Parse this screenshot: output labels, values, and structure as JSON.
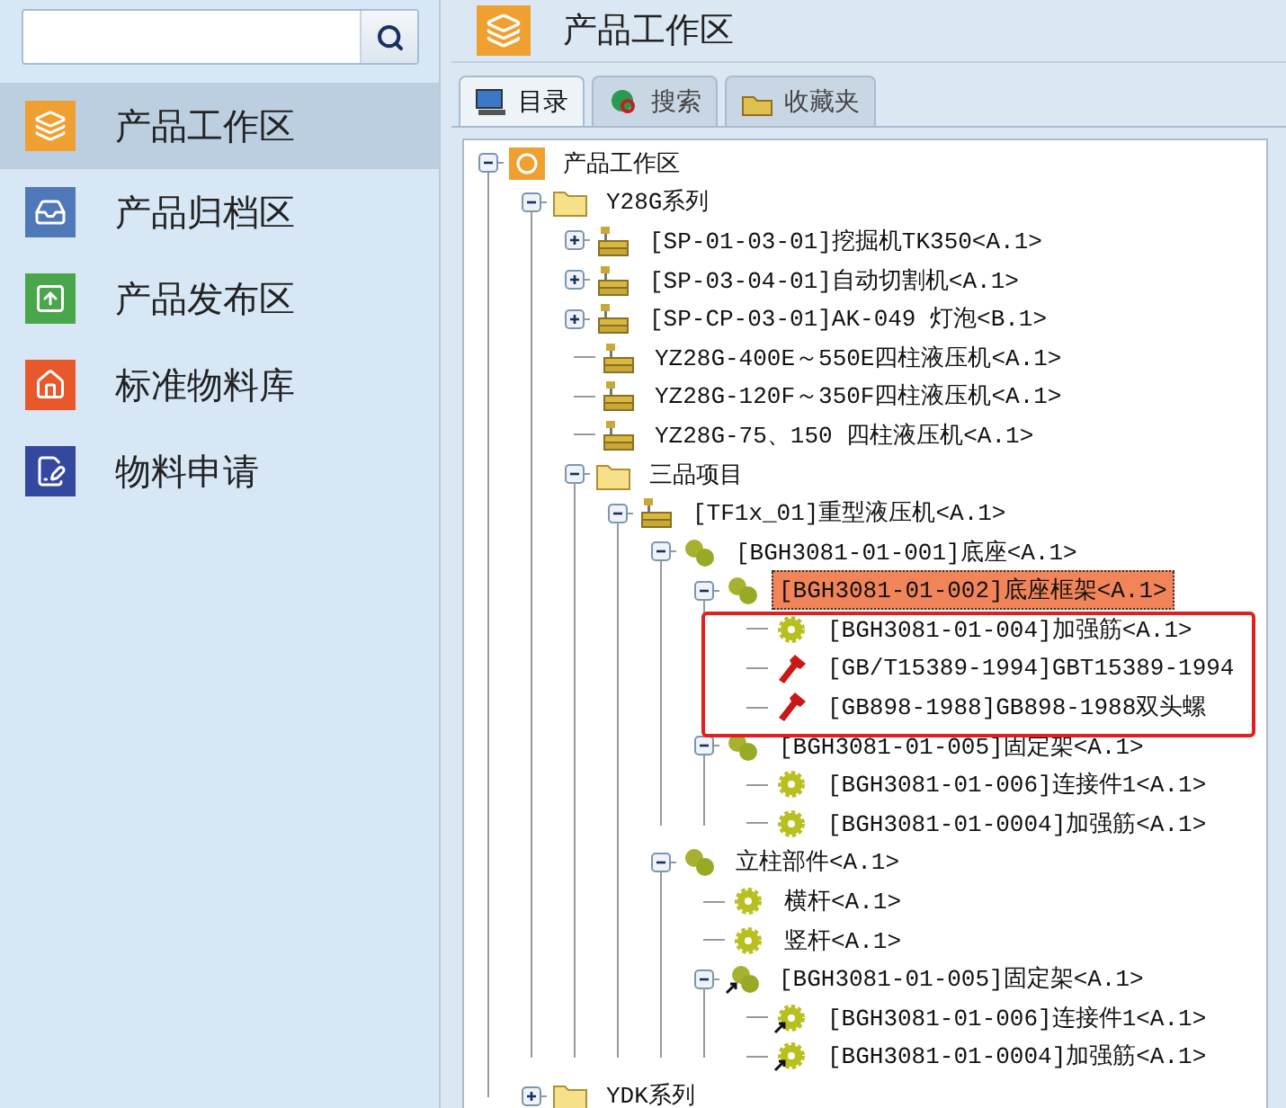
{
  "nav": [
    {
      "label": "产品工作区",
      "color": "#f0a030",
      "selected": true
    },
    {
      "label": "产品归档区",
      "color": "#4f78b8",
      "selected": false
    },
    {
      "label": "产品发布区",
      "color": "#4aa64a",
      "selected": false
    },
    {
      "label": "标准物料库",
      "color": "#e8582a",
      "selected": false
    },
    {
      "label": "物料申请",
      "color": "#3448a0",
      "selected": false
    }
  ],
  "header": {
    "title": "产品工作区"
  },
  "tabs": [
    {
      "label": "目录",
      "selected": true
    },
    {
      "label": "搜索",
      "selected": false
    },
    {
      "label": "收藏夹",
      "selected": false
    }
  ],
  "tree": [
    {
      "label": "产品工作区",
      "kind": "root",
      "expanded": true,
      "selected": false,
      "children": [
        {
          "label": "Y28G系列",
          "kind": "folder",
          "expanded": true,
          "selected": false,
          "children": [
            {
              "label": "[SP-01-03-01]挖掘机TK350<A.1>",
              "kind": "product",
              "expanded": false,
              "selected": false
            },
            {
              "label": "[SP-03-04-01]自动切割机<A.1>",
              "kind": "product",
              "expanded": false,
              "selected": false
            },
            {
              "label": "[SP-CP-03-01]AK-049 灯泡<B.1>",
              "kind": "product",
              "expanded": false,
              "selected": false
            },
            {
              "label": "YZ28G-400E～550E四柱液压机<A.1>",
              "kind": "product",
              "selected": false
            },
            {
              "label": "YZ28G-120F～350F四柱液压机<A.1>",
              "kind": "product",
              "selected": false
            },
            {
              "label": "YZ28G-75、150 四柱液压机<A.1>",
              "kind": "product",
              "selected": false
            },
            {
              "label": "三品项目",
              "kind": "folder",
              "expanded": true,
              "selected": false,
              "children": [
                {
                  "label": "[TF1x_01]重型液压机<A.1>",
                  "kind": "product",
                  "expanded": true,
                  "selected": false,
                  "children": [
                    {
                      "label": "[BGH3081-01-001]底座<A.1>",
                      "kind": "assembly",
                      "expanded": true,
                      "selected": false,
                      "children": [
                        {
                          "label": "[BGH3081-01-002]底座框架<A.1>",
                          "kind": "assembly",
                          "expanded": true,
                          "selected": true,
                          "children": [
                            {
                              "label": "[BGH3081-01-004]加强筋<A.1>",
                              "kind": "part",
                              "selected": false
                            },
                            {
                              "label": "[GB/T15389-1994]GBT15389-1994",
                              "kind": "standard",
                              "selected": false
                            },
                            {
                              "label": "[GB898-1988]GB898-1988双头螺",
                              "kind": "standard",
                              "selected": false
                            }
                          ]
                        },
                        {
                          "label": "[BGH3081-01-005]固定架<A.1>",
                          "kind": "assembly",
                          "expanded": true,
                          "selected": false,
                          "children": [
                            {
                              "label": "[BGH3081-01-006]连接件1<A.1>",
                              "kind": "part",
                              "selected": false
                            },
                            {
                              "label": "[BGH3081-01-0004]加强筋<A.1>",
                              "kind": "part",
                              "selected": false
                            }
                          ]
                        }
                      ]
                    },
                    {
                      "label": "立柱部件<A.1>",
                      "kind": "assembly",
                      "expanded": true,
                      "selected": false,
                      "children": [
                        {
                          "label": "横杆<A.1>",
                          "kind": "part",
                          "selected": false
                        },
                        {
                          "label": "竖杆<A.1>",
                          "kind": "part",
                          "selected": false
                        },
                        {
                          "label": "[BGH3081-01-005]固定架<A.1>",
                          "kind": "link-assembly",
                          "expanded": true,
                          "selected": false,
                          "children": [
                            {
                              "label": "[BGH3081-01-006]连接件1<A.1>",
                              "kind": "link-part",
                              "selected": false
                            },
                            {
                              "label": "[BGH3081-01-0004]加强筋<A.1>",
                              "kind": "link-part",
                              "selected": false
                            }
                          ]
                        }
                      ]
                    }
                  ]
                }
              ]
            }
          ]
        },
        {
          "label": "YDK系列",
          "kind": "folder",
          "expanded": false,
          "selected": false
        }
      ]
    }
  ]
}
